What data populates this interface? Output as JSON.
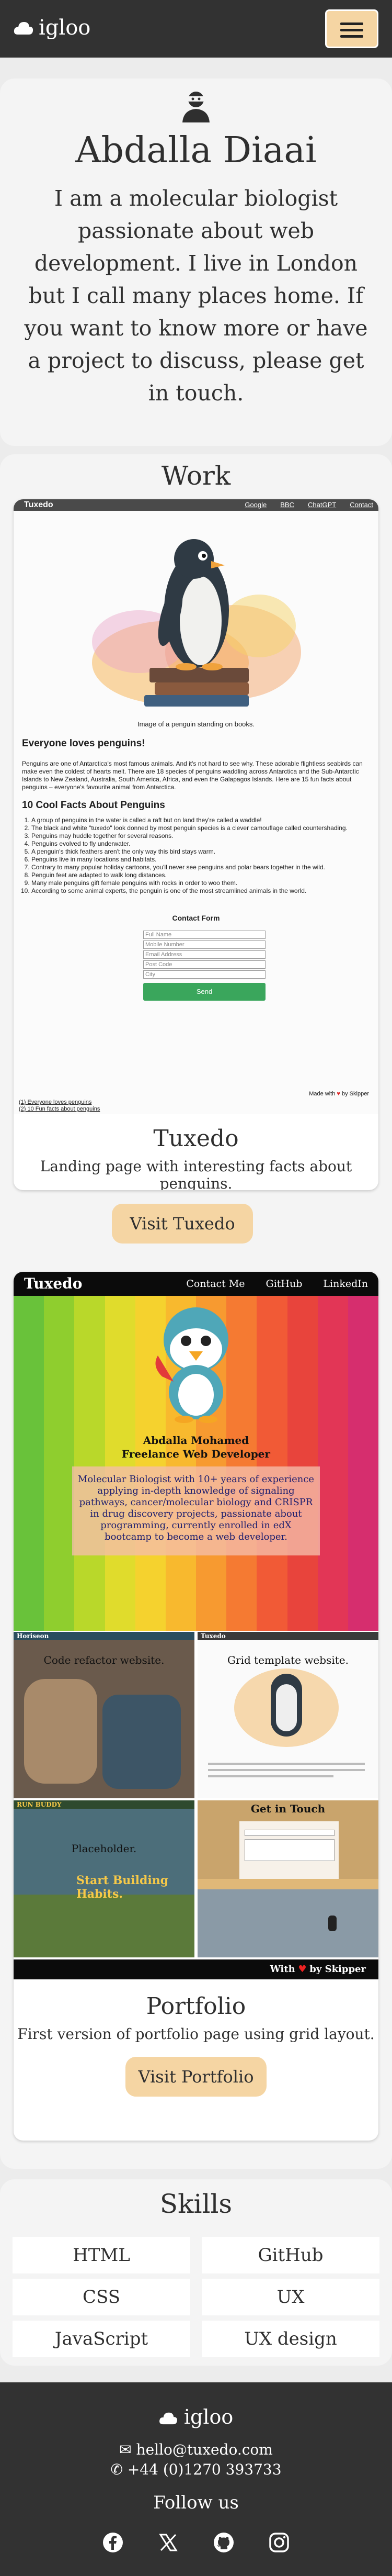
{
  "nav": {
    "logo_text": "igloo",
    "logo_icon": "cloud-icon",
    "menu_icon": "hamburger-icon"
  },
  "hero": {
    "avatar_icon": "user-ninja-icon",
    "name": "Abdalla Diaai",
    "bio": "I am a molecular biologist passionate about web development. I live in London but I call many places home. If you want to know more or have a project to discuss, please get in touch."
  },
  "work": {
    "title": "Work",
    "projects": [
      {
        "title": "Tuxedo",
        "description": "Landing page with interesting facts about penguins.",
        "button": "Visit Tuxedo",
        "screenshot": {
          "brand": "Tuxedo",
          "links": [
            "Google",
            "BBC",
            "ChatGPT",
            "Contact"
          ],
          "caption": "Image of a penguin standing on books.",
          "heading": "Everyone loves penguins!",
          "intro": "Penguins are one of Antarctica's most famous animals. And it's not hard to see why. These adorable flightless seabirds can make even the coldest of hearts melt. There are 18 species of penguins waddling across Antarctica and the Sub-Antarctic Islands to New Zealand, Australia, South America, Africa, and even the Galapagos Islands. Here are 15 fun facts about penguins – everyone's favourite animal from Antarctica.",
          "facts_heading": "10 Cool Facts About Penguins",
          "facts": [
            "A group of penguins in the water is called a raft but on land they're called a waddle!",
            "The black and white \"tuxedo\" look donned by most penguin species is a clever camouflage called countershading.",
            "Penguins may huddle together for several reasons.",
            "Penguins evolved to fly underwater.",
            "A penguin's thick feathers aren't the only way this bird stays warm.",
            "Penguins live in many locations and habitats.",
            "Contrary to many popular holiday cartoons, you'll never see penguins and polar bears together in the wild.",
            "Penguin feet are adapted to walk long distances.",
            "Many male penguins gift female penguins with rocks in order to woo them.",
            "According to some animal experts, the penguin is one of the most streamlined animals in the world."
          ],
          "form_title": "Contact Form",
          "fields": [
            "Full Name",
            "Mobile Number",
            "Email Address",
            "Post Code",
            "City"
          ],
          "send": "Send",
          "made_with": "Made with",
          "made_by": "by Skipper",
          "footnotes": [
            "(1) Everyone loves penguins",
            "(2) 10 Fun facts about penguins"
          ]
        }
      },
      {
        "title": "Portfolio",
        "description": "First version of portfolio page using grid layout.",
        "button": "Visit Portfolio",
        "screenshot": {
          "brand": "Tuxedo",
          "links": [
            "Contact Me",
            "GitHub",
            "LinkedIn"
          ],
          "name": "Abdalla Mohamed",
          "role": "Freelance Web Developer",
          "blurb": "Molecular Biologist with 10+ years of experience applying in-depth knowledge of signaling pathways, cancer/molecular biology and CRISPR in drug discovery projects, passionate about programming, currently enrolled in edX bootcamp to become a web developer.",
          "thumb1_label": "Code refactor website.",
          "thumb1_brand": "Horiseon",
          "thumb2_label": "Grid template website.",
          "thumb2_brand": "Tuxedo",
          "thumb3_label": "Placeholder.",
          "thumb3_brand": "RUN BUDDY",
          "thumb3_text": "Start Building Habits.",
          "thumb4_label": "Get in Touch",
          "footer_text": "With",
          "footer_by": "by Skipper"
        }
      }
    ]
  },
  "skills": {
    "title": "Skills",
    "items": [
      "HTML",
      "GitHub",
      "CSS",
      "UX",
      "JavaScript",
      "UX design"
    ]
  },
  "footer": {
    "logo_text": "igloo",
    "email": "hello@tuxedo.com",
    "phone": "+44 (0)1270 393733",
    "follow": "Follow us",
    "socials": [
      "facebook-icon",
      "x-icon",
      "github-icon",
      "instagram-icon"
    ]
  },
  "colors": {
    "dark": "#323232",
    "accent": "#f5d5a3",
    "card": "#f4f4f4",
    "page": "#ececec"
  }
}
